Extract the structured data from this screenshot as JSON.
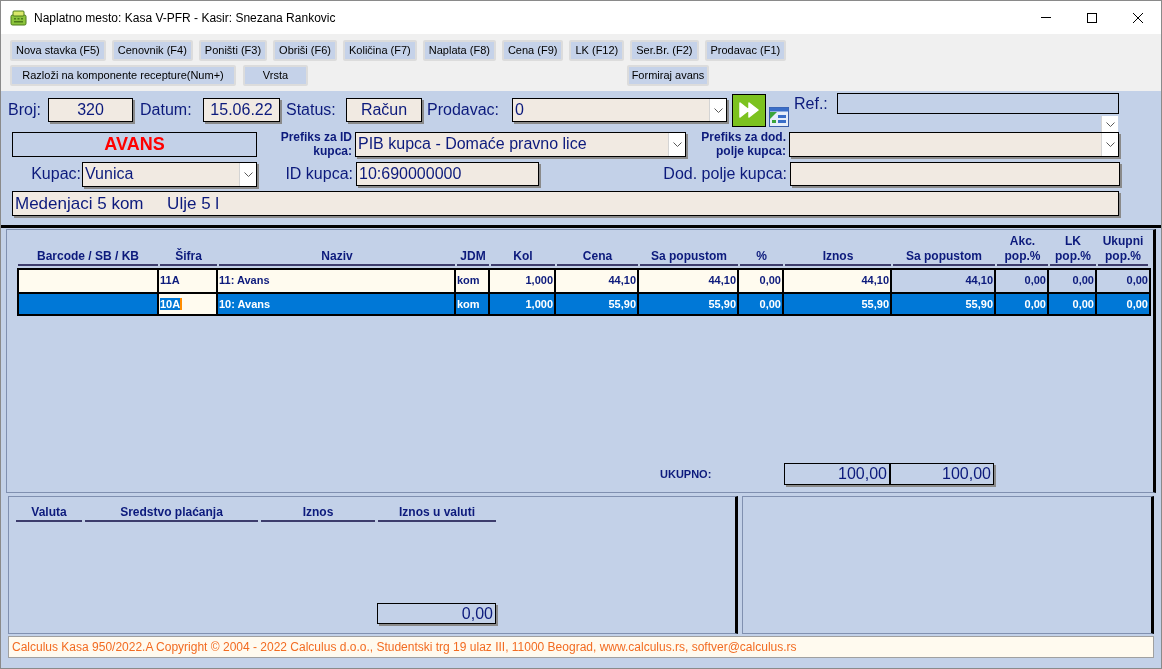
{
  "window": {
    "title": "Naplatno mesto: Kasa V-PFR - Kasir: Snezana Rankovic"
  },
  "toolbar": {
    "buttons": [
      "Nova stavka (F5)",
      "Cenovnik (F4)",
      "Poništi (F3)",
      "Obriši (F6)",
      "Količina (F7)",
      "Naplata (F8)",
      "Cena (F9)",
      "LK (F12)",
      "Ser.Br. (F2)",
      "Prodavac (F1)"
    ],
    "second_row_buttons": [
      "Razloži na komponente recepture(Num+)",
      "Vrsta"
    ],
    "advance_button": "Formiraj avans"
  },
  "header": {
    "number": {
      "label": "Broj:",
      "value": "320"
    },
    "date": {
      "label": "Datum:",
      "value": "15.06.22"
    },
    "status": {
      "label": "Status:",
      "value": "Račun"
    },
    "seller": {
      "label": "Prodavac:",
      "value": "0"
    },
    "reference": {
      "label": "Ref.:"
    },
    "document_type": "AVANS",
    "id_prefix": {
      "label": "Prefiks za ID kupca:",
      "value": "PIB kupca - Domaće pravno lice"
    },
    "extra_prefix": {
      "label": "Prefiks za dod. polje kupca:"
    },
    "customer": {
      "label": "Kupac:",
      "value": "Vunica"
    },
    "customer_id": {
      "label": "ID kupca:",
      "value": "10:690000000"
    },
    "extra_field": {
      "label": "Dod. polje kupca:"
    },
    "note": "Medenjaci 5 kom     Ulje 5 l"
  },
  "items": {
    "columns": [
      {
        "label": "Barcode / SB / KB",
        "read_only": false
      },
      {
        "label": "Šifra",
        "read_only": false
      },
      {
        "label": "Naziv",
        "read_only": false
      },
      {
        "label": "JDM",
        "read_only": false
      },
      {
        "label": "Kol",
        "read_only": false
      },
      {
        "label": "Cena",
        "read_only": false
      },
      {
        "label": "Sa popustom",
        "read_only": false
      },
      {
        "label": "%",
        "read_only": false
      },
      {
        "label": "Iznos",
        "read_only": false
      },
      {
        "label": "Sa popustom",
        "read_only": true
      },
      {
        "label": "Akc. pop.%",
        "read_only": true
      },
      {
        "label": "LK pop.%",
        "read_only": true
      },
      {
        "label": "Ukupni pop.%",
        "read_only": true
      }
    ],
    "rows": [
      {
        "selected": false,
        "editing": false,
        "code": "11A",
        "name": "11: Avans",
        "unit": "kom",
        "quantity": "1,000",
        "price": "44,10",
        "price_discounted": "44,10",
        "discount_pct": "0,00",
        "amount": "44,10",
        "amount_discounted": "44,10",
        "promo_discount_pct": "0,00",
        "loyalty_discount_pct": "0,00",
        "total_discount_pct": "0,00"
      },
      {
        "selected": true,
        "editing": true,
        "code": "10A",
        "name": "10: Avans",
        "unit": "kom",
        "quantity": "1,000",
        "price": "55,90",
        "price_discounted": "55,90",
        "discount_pct": "0,00",
        "amount": "55,90",
        "amount_discounted": "55,90",
        "promo_discount_pct": "0,00",
        "loyalty_discount_pct": "0,00",
        "total_discount_pct": "0,00"
      }
    ],
    "total": {
      "label": "UKUPNO:",
      "amount": "100,00",
      "amount_discounted": "100,00"
    }
  },
  "payments": {
    "columns": [
      "Valuta",
      "Sredstvo plaćanja",
      "Iznos",
      "Iznos u valuti"
    ],
    "total": "0,00"
  },
  "status_bar": "Calculus Kasa 950/2022.A Copyright © 2004 - 2022 Calculus d.o.o., Studentski trg 19 ulaz III, 11000 Beograd, www.calculus.rs, softver@calculus.rs"
}
